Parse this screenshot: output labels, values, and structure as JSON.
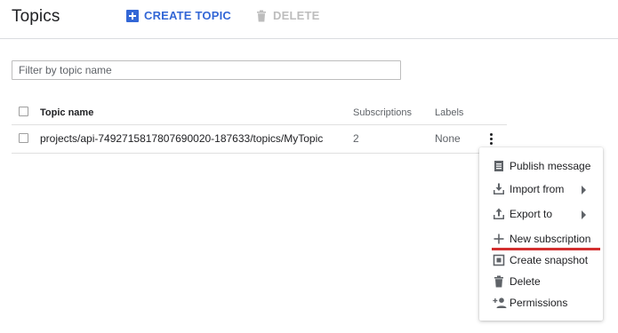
{
  "header": {
    "title": "Topics",
    "create_label": "CREATE TOPIC",
    "delete_label": "DELETE"
  },
  "filter": {
    "placeholder": "Filter by topic name"
  },
  "table": {
    "columns": [
      "Topic name",
      "Subscriptions",
      "Labels"
    ],
    "rows": [
      {
        "name": "projects/api-7492715817807690020-187633/topics/MyTopic",
        "subscriptions": "2",
        "labels": "None"
      }
    ]
  },
  "menu": {
    "items": [
      {
        "label": "Publish message",
        "icon": "publish-icon",
        "submenu": false
      },
      {
        "label": "Import from",
        "icon": "import-icon",
        "submenu": true
      },
      {
        "label": "Export to",
        "icon": "export-icon",
        "submenu": true
      },
      {
        "label": "New subscription",
        "icon": "plus-icon",
        "submenu": false,
        "highlighted": true
      },
      {
        "label": "Create snapshot",
        "icon": "snapshot-icon",
        "submenu": false
      },
      {
        "label": "Delete",
        "icon": "trash-icon",
        "submenu": false
      },
      {
        "label": "Permissions",
        "icon": "add-person-icon",
        "submenu": false
      }
    ]
  },
  "colors": {
    "accent": "#3367d6",
    "disabled": "#bdbdbd",
    "highlight_underline": "#d32f2f"
  }
}
